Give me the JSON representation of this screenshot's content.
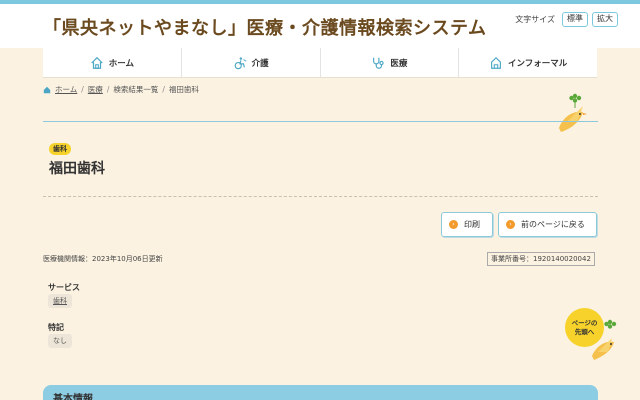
{
  "header": {
    "site_title": "「県央ネットやまなし」医療・介護情報検索システム",
    "font_size_label": "文字サイズ",
    "font_size_normal": "標準",
    "font_size_large": "拡大"
  },
  "nav": {
    "items": [
      {
        "label": "ホーム",
        "icon": "home-icon"
      },
      {
        "label": "介護",
        "icon": "wheelchair-icon"
      },
      {
        "label": "医療",
        "icon": "stethoscope-icon"
      },
      {
        "label": "インフォーマル",
        "icon": "house-icon"
      }
    ]
  },
  "breadcrumb": {
    "home": "ホーム",
    "medical": "医療",
    "results": "検索結果一覧",
    "current": "福田歯科"
  },
  "facility": {
    "category": "歯科",
    "name": "福田歯科",
    "updated": "医療機関情報：2023年10月06日更新",
    "office_number": "事業所番号：1920140020042"
  },
  "actions": {
    "print": "印刷",
    "back": "前のページに戻る"
  },
  "fields": {
    "service_label": "サービス",
    "service_value": "歯科",
    "special_label": "特記",
    "special_value": "なし"
  },
  "page_top": {
    "line1": "ページの",
    "line2": "先頭へ"
  },
  "section": {
    "basic_info": "基本情報"
  },
  "colors": {
    "accent_blue": "#7cc8de",
    "title_brown": "#6b4a1f",
    "badge_yellow": "#f6d22b",
    "button_orange": "#f39a2d",
    "background": "#fbf2e1"
  }
}
